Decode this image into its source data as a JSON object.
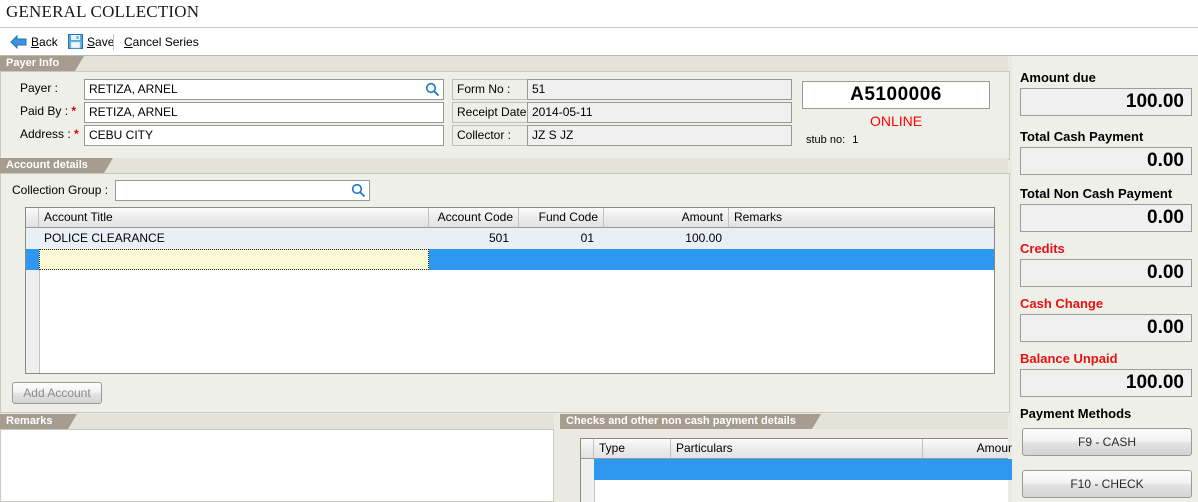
{
  "window": {
    "title": "GENERAL COLLECTION"
  },
  "toolbar": {
    "back_label": "Back",
    "save_label": "Save",
    "cancel_label": "Cancel Series",
    "back_icon": "back-arrow-icon",
    "save_icon": "floppy-disk-icon"
  },
  "payer_info": {
    "panel_title": "Payer Info",
    "fields": {
      "payer_label": "Payer :",
      "payer_value": "RETIZA, ARNEL",
      "paid_by_label": "Paid By :",
      "paid_by_required": "*",
      "paid_by_value": "RETIZA, ARNEL",
      "address_label": "Address :",
      "address_required": "*",
      "address_value": "CEBU CITY",
      "form_no_label": "Form No :",
      "form_no_value": "51",
      "receipt_date_label": "Receipt Date :",
      "receipt_date_value": "2014-05-11",
      "collector_label": "Collector :",
      "collector_value": "JZ S JZ"
    },
    "receipt": {
      "number": "A5100006",
      "status": "ONLINE",
      "stub_label": "stub no:",
      "stub_value": "1"
    },
    "search_icon": "search-icon"
  },
  "account_details": {
    "panel_title": "Account details",
    "collection_group_label": "Collection Group :",
    "collection_group_value": "",
    "search_icon": "search-icon",
    "grid": {
      "columns": [
        "Account Title",
        "Account Code",
        "Fund Code",
        "Amount",
        "Remarks"
      ],
      "rows": [
        {
          "account_title": "POLICE CLEARANCE",
          "account_code": "501",
          "fund_code": "01",
          "amount": "100.00",
          "remarks": ""
        },
        {
          "account_title": "",
          "account_code": "",
          "fund_code": "",
          "amount": "",
          "remarks": ""
        }
      ]
    },
    "add_account_label": "Add Account"
  },
  "remarks": {
    "panel_title": "Remarks",
    "value": ""
  },
  "checks": {
    "panel_title": "Checks and other non cash payment details",
    "columns": [
      "Type",
      "Particulars",
      "Amount"
    ],
    "rows": [
      {
        "type": "",
        "particulars": "",
        "amount": ""
      }
    ]
  },
  "sidebar": {
    "amount_due_label": "Amount due",
    "amount_due_value": "100.00",
    "total_cash_label": "Total Cash Payment",
    "total_cash_value": "0.00",
    "total_noncash_label": "Total Non Cash Payment",
    "total_noncash_value": "0.00",
    "credits_label": "Credits",
    "credits_value": "0.00",
    "cash_change_label": "Cash Change",
    "cash_change_value": "0.00",
    "balance_unpaid_label": "Balance Unpaid",
    "balance_unpaid_value": "100.00",
    "payment_methods_label": "Payment Methods",
    "cash_button_label": "F9 - CASH",
    "check_button_label": "F10 - CHECK"
  },
  "colors": {
    "panel_tab": "#A79C90",
    "selection_blue": "#2E97F0",
    "alert_red": "#ff0000",
    "edit_cell_yellow": "#FAFAD7"
  }
}
